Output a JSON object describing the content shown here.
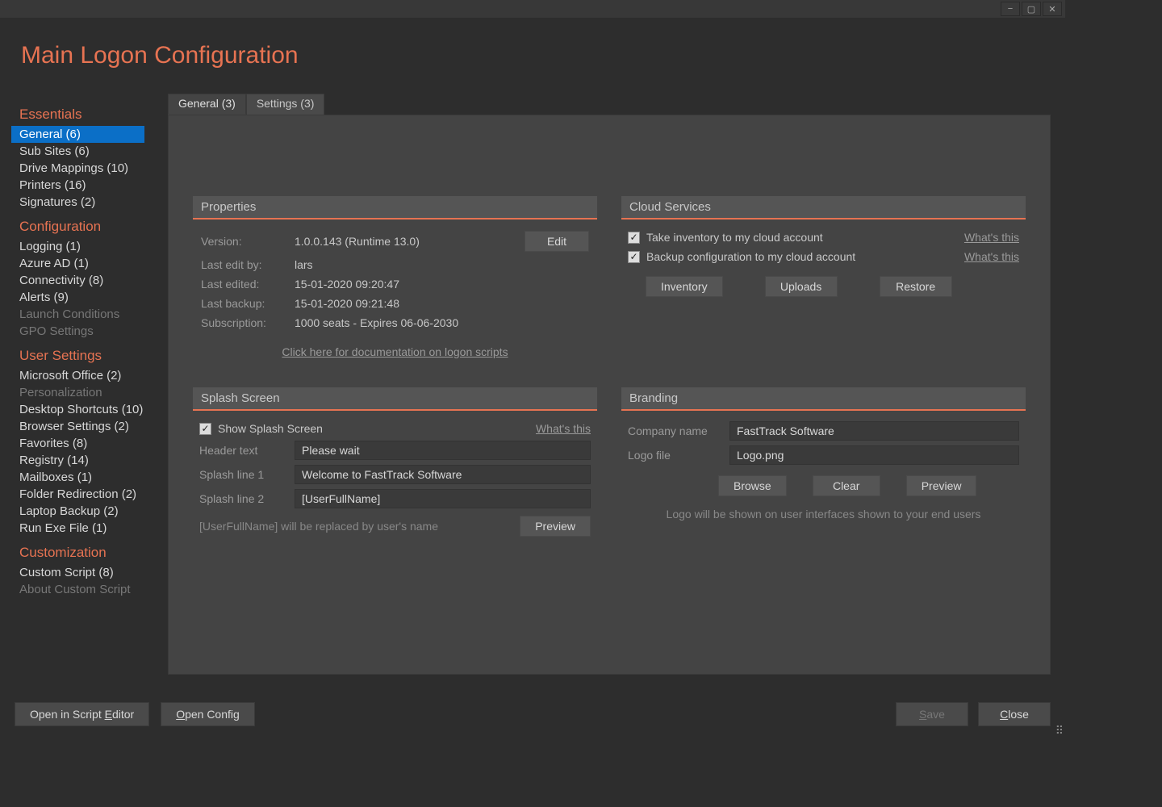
{
  "page_title": "Main Logon Configuration",
  "window_controls": {
    "min": "−",
    "max": "▢",
    "close": "✕"
  },
  "sidebar": {
    "sections": [
      {
        "title": "Essentials",
        "items": [
          {
            "label": "General (6)",
            "selected": true
          },
          {
            "label": "Sub Sites (6)"
          },
          {
            "label": "Drive Mappings (10)"
          },
          {
            "label": "Printers (16)"
          },
          {
            "label": "Signatures (2)"
          }
        ]
      },
      {
        "title": "Configuration",
        "items": [
          {
            "label": "Logging (1)"
          },
          {
            "label": "Azure AD (1)"
          },
          {
            "label": "Connectivity (8)"
          },
          {
            "label": "Alerts (9)"
          },
          {
            "label": "Launch Conditions",
            "disabled": true
          },
          {
            "label": "GPO Settings",
            "disabled": true
          }
        ]
      },
      {
        "title": "User Settings",
        "items": [
          {
            "label": "Microsoft Office (2)"
          },
          {
            "label": "Personalization",
            "disabled": true
          },
          {
            "label": "Desktop Shortcuts (10)"
          },
          {
            "label": "Browser Settings (2)"
          },
          {
            "label": "Favorites (8)"
          },
          {
            "label": "Registry (14)"
          },
          {
            "label": "Mailboxes (1)"
          },
          {
            "label": "Folder Redirection (2)"
          },
          {
            "label": "Laptop Backup (2)"
          },
          {
            "label": "Run Exe File (1)"
          }
        ]
      },
      {
        "title": "Customization",
        "items": [
          {
            "label": "Custom Script (8)"
          },
          {
            "label": "About Custom Script",
            "disabled": true
          }
        ]
      }
    ]
  },
  "tabs": [
    {
      "label": "General (3)",
      "active": true
    },
    {
      "label": "Settings (3)"
    }
  ],
  "properties": {
    "title": "Properties",
    "version_label": "Version:",
    "version_value": "1.0.0.143 (Runtime 13.0)",
    "edit_btn": "Edit",
    "editby_label": "Last edit by:",
    "editby_value": "lars",
    "edited_label": "Last edited:",
    "edited_value": "15-01-2020 09:20:47",
    "backup_label": "Last backup:",
    "backup_value": "15-01-2020 09:21:48",
    "sub_label": "Subscription:",
    "sub_value": "1000 seats  -  Expires 06-06-2030",
    "doc_link": "Click here for documentation on logon scripts"
  },
  "cloud": {
    "title": "Cloud Services",
    "inventory_label": "Take inventory to my cloud account",
    "backup_label": "Backup configuration to my cloud account",
    "whats": "What's this",
    "btn_inventory": "Inventory",
    "btn_uploads": "Uploads",
    "btn_restore": "Restore"
  },
  "splash": {
    "title": "Splash Screen",
    "show_label": "Show Splash Screen",
    "whats": "What's this",
    "header_label": "Header text",
    "header_value": "Please wait",
    "line1_label": "Splash line 1",
    "line1_value": "Welcome to FastTrack Software",
    "line2_label": "Splash line 2",
    "line2_value": "[UserFullName]",
    "hint": "[UserFullName] will be replaced by user's name",
    "preview_btn": "Preview"
  },
  "branding": {
    "title": "Branding",
    "company_label": "Company name",
    "company_value": "FastTrack Software",
    "logo_label": "Logo file",
    "logo_value": "Logo.png",
    "btn_browse": "Browse",
    "btn_clear": "Clear",
    "btn_preview": "Preview",
    "hint": "Logo will be shown on user interfaces shown to your end users"
  },
  "bottom": {
    "open_editor_pre": "Open in Script ",
    "open_editor_ul": "E",
    "open_editor_post": "ditor",
    "open_config_ul": "O",
    "open_config_post": "pen Config",
    "save_ul": "S",
    "save_post": "ave",
    "close_ul": "C",
    "close_post": "lose"
  }
}
